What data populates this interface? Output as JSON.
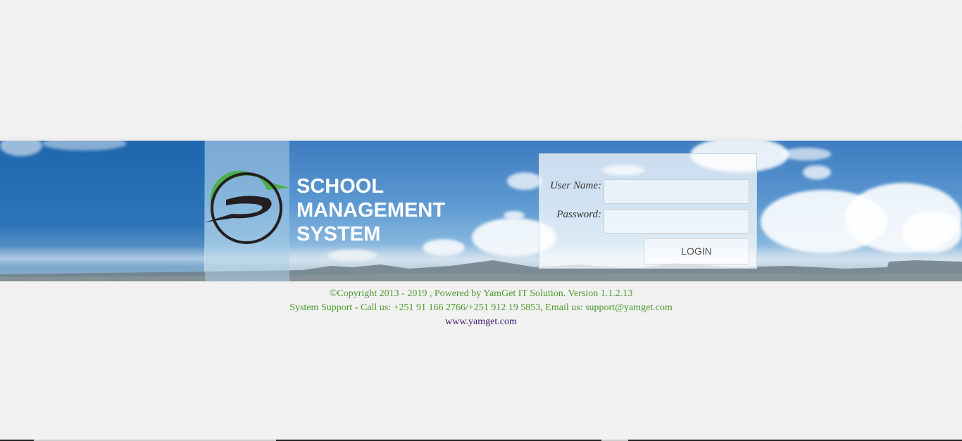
{
  "header": {
    "title_lines": [
      "SCHOOL",
      "MANAGEMENT",
      "SYSTEM"
    ]
  },
  "login": {
    "username_label": "User Name:",
    "username_value": "",
    "password_label": "Password:",
    "password_value": "",
    "login_button": "LOGIN"
  },
  "footer": {
    "copyright": "©Copyright 2013 - 2019 , Powered by YamGet IT Solution. Version 1.1.2.13",
    "support": "System Support - Call us: +251 91 166 2766/+251 912 19 5853, Email us: support@yamget.com",
    "website": "www.yamget.com"
  },
  "colors": {
    "logo_green": "#4cb04c",
    "logo_black": "#231f20",
    "footer_text": "#4a9a2a",
    "link": "#3d1a78",
    "title": "#ffffff"
  },
  "icons": {
    "logo": "school-logo-icon"
  }
}
